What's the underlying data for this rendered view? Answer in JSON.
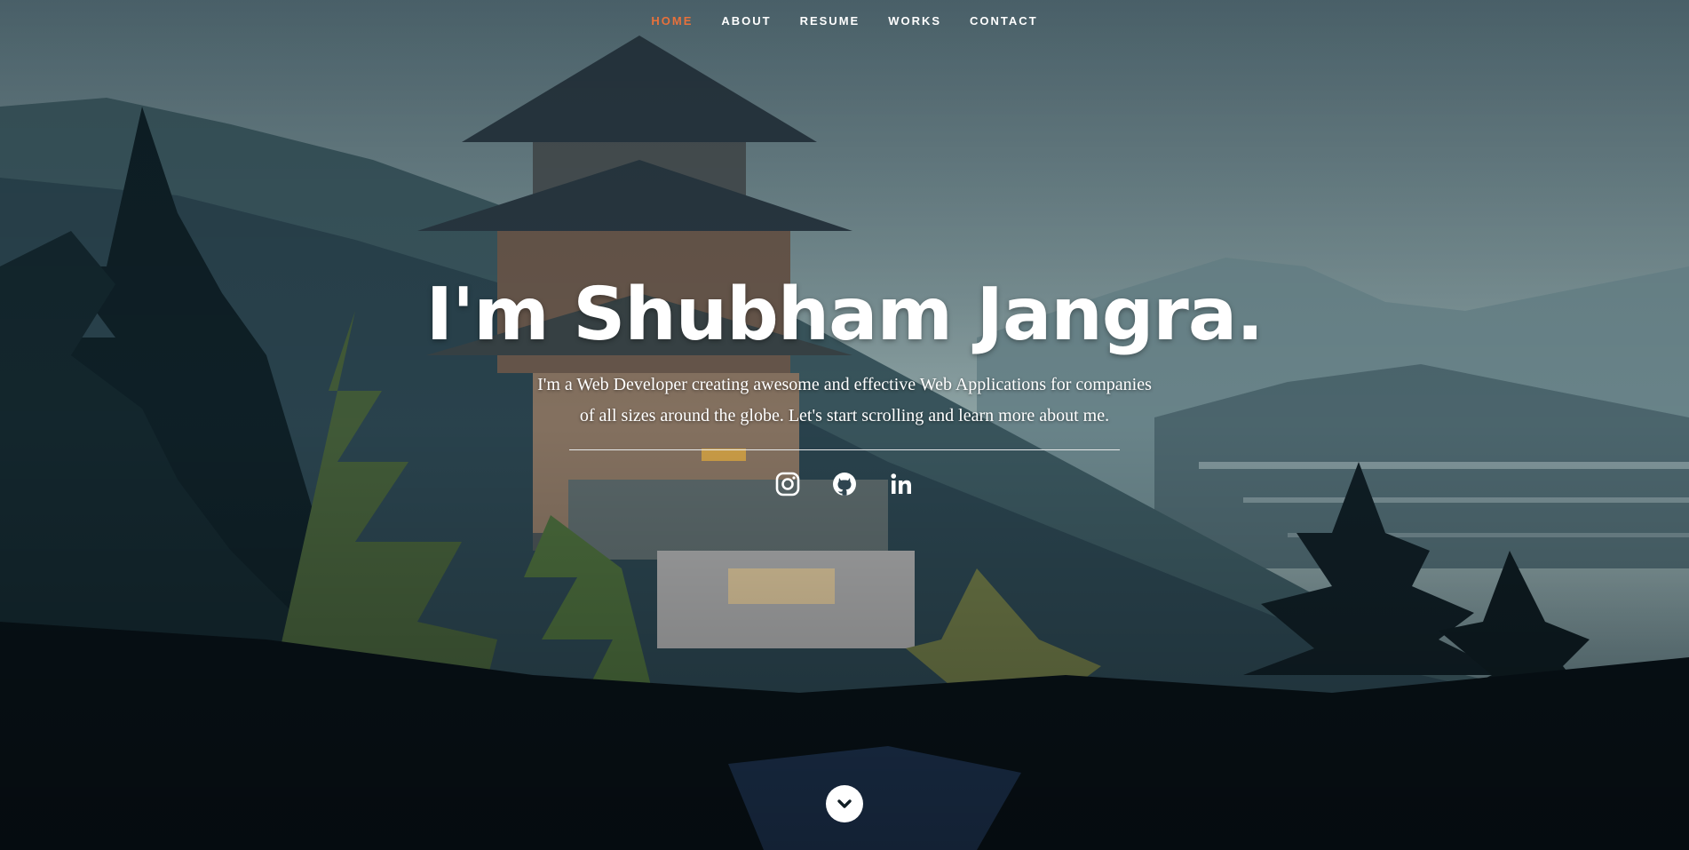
{
  "nav": {
    "items": [
      {
        "label": "HOME",
        "active": true
      },
      {
        "label": "ABOUT",
        "active": false
      },
      {
        "label": "RESUME",
        "active": false
      },
      {
        "label": "WORKS",
        "active": false
      },
      {
        "label": "CONTACT",
        "active": false
      }
    ],
    "active_color": "#e8713b"
  },
  "banner": {
    "title": "I'm Shubham Jangra.",
    "subtitle": "I'm a Web Developer creating awesome and effective Web Applications for companies of all sizes around the globe. Let's start scrolling and learn more about me."
  },
  "social": [
    {
      "icon": "instagram-icon"
    },
    {
      "icon": "github-icon"
    },
    {
      "icon": "linkedin-icon"
    }
  ],
  "scroll_button": {
    "icon": "chevron-down-icon"
  },
  "background": {
    "description_icon": "pixel-art-pagoda-forest-background",
    "sky_color": "#5f7a80",
    "forest_dark": "#0c1a20"
  }
}
